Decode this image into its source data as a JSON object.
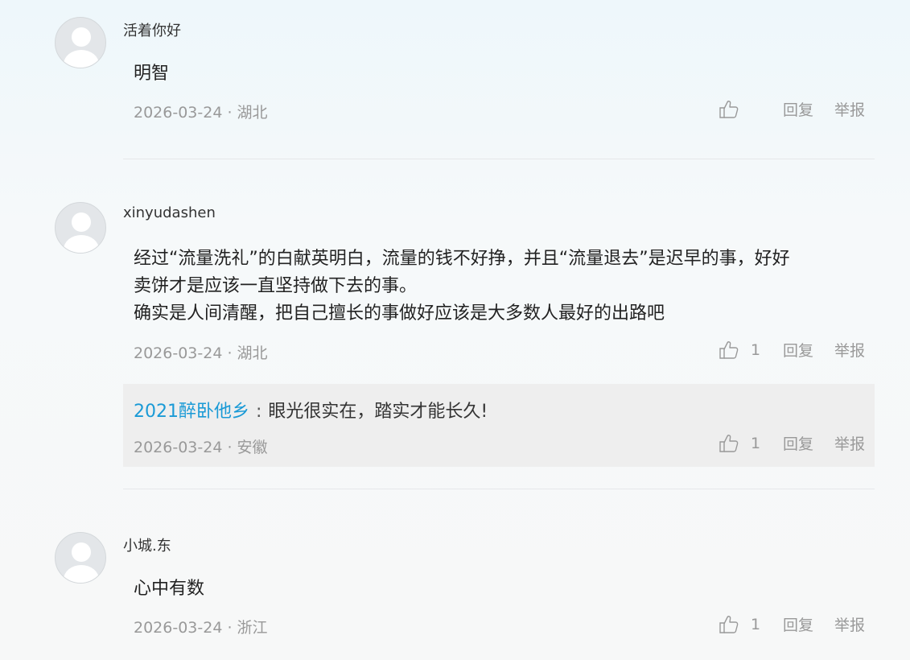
{
  "comments": [
    {
      "username": "活着你好",
      "content_lines": [
        "明智"
      ],
      "meta": "2026-03-24 · 湖北",
      "like_count": "",
      "reply_label": "回复",
      "report_label": "举报"
    },
    {
      "username": "xinyudashen",
      "content_lines": [
        "经过“流量洗礼”的白献英明白，流量的钱不好挣，并且“流量退去”是迟早的事，好好",
        "卖饼才是应该一直坚持做下去的事。",
        "确实是人间清醒，把自己擅长的事做好应该是大多数人最好的出路吧"
      ],
      "meta": "2026-03-24 · 湖北",
      "like_count": "1",
      "reply_label": "回复",
      "report_label": "举报",
      "reply": {
        "username": "2021醉卧他乡",
        "colon": ":",
        "text": "眼光很实在，踏实才能长久!",
        "meta": "2026-03-24 · 安徽",
        "like_count": "1",
        "reply_label": "回复",
        "report_label": "举报"
      }
    },
    {
      "username": "小城.东",
      "content_lines": [
        "心中有数"
      ],
      "meta": "2026-03-24 · 浙江",
      "like_count": "1",
      "reply_label": "回复",
      "report_label": "举报"
    }
  ],
  "icons": {
    "avatar": "default-avatar-icon",
    "like": "thumbs-up-icon"
  },
  "colors": {
    "reply_username": "#1a9ad6",
    "meta_text": "#999999",
    "reply_background": "#eeeeee"
  }
}
